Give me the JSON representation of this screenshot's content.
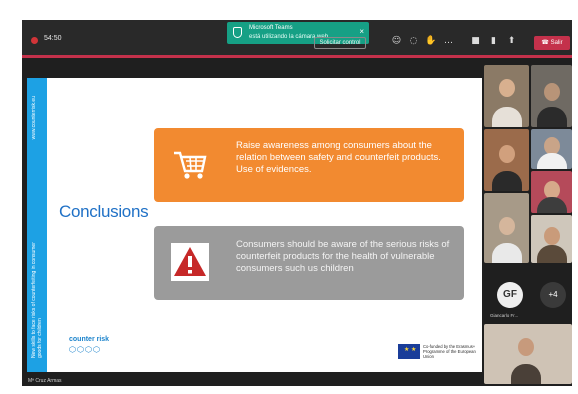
{
  "meeting": {
    "timer": "54:50",
    "control_button": "Solicitar control",
    "leave_button": "Salir",
    "toolbar_icons": [
      "people-icon",
      "chat-icon",
      "raise-hand-icon",
      "more-icon",
      "camera-icon",
      "microphone-icon",
      "share-icon",
      "phone-icon"
    ]
  },
  "notification": {
    "app": "Microsoft Teams",
    "message": "está utilizando la cámara web"
  },
  "slide": {
    "title": "Conclusions",
    "sidebar_url": "www.counterrisk.eu",
    "sidebar_tagline": "New skills to face risks of counterfeiting in consumer goods for children",
    "box1_text": "Raise awareness among consumers about the relation between safety and counterfeit products. Use of evidences.",
    "box1_icon": "shopping-cart-icon",
    "box2_text": "Consumers should be aware of the serious risks of counterfeit products for the health of vulnerable consumers such us children",
    "box2_icon": "warning-icon",
    "logo_text": "counter risk",
    "eu_text": "Co-funded by the Erasmus+ Programme of the European Union",
    "colors": {
      "accent_blue": "#1da1e4",
      "orange": "#f28a30",
      "grey": "#9b9b9b"
    }
  },
  "participants": {
    "initials": "GF",
    "name_label": "Giancarlo Fr...",
    "more_label": "+4"
  },
  "bottom_caption": "Mª Cruz Armas"
}
